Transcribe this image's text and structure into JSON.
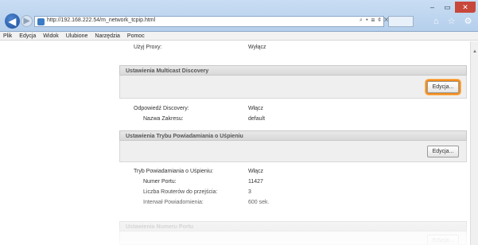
{
  "browser": {
    "url": "http://192.168.222.54/m_network_tcpip.html",
    "window_controls": {
      "minimize": "–",
      "maximize": "▭",
      "close": "✕"
    },
    "address_tools": "⌕ ▾ ⊞ ¢ ✕",
    "toolbar_icons": "⌂ ☆ ⚙"
  },
  "menu": [
    "Plik",
    "Edycja",
    "Widok",
    "Ulubione",
    "Narzędzia",
    "Pomoc"
  ],
  "proxy": {
    "label": "Użyj Proxy:",
    "value": "Wyłącz"
  },
  "multicast": {
    "title": "Ustawienia Multicast Discovery",
    "edit_label": "Edycja...",
    "response_label": "Odpowiedź Discovery:",
    "response_value": "Włącz",
    "scope_label": "Nazwa Zakresu:",
    "scope_value": "default"
  },
  "sleep": {
    "title": "Ustawienia Trybu Powiadamiania o Uśpieniu",
    "edit_label": "Edycja...",
    "mode_label": "Tryb Powiadamiania o Uśpieniu:",
    "mode_value": "Włącz",
    "port_label": "Numer Portu:",
    "port_value": "11427",
    "routers_label": "Liczba Routerów do przejścia:",
    "routers_value": "3",
    "interval_label": "Interwał Powiadomienia:",
    "interval_value": "600 sek."
  },
  "port_numbers": {
    "title": "Ustawienia Numeru Portu",
    "edit_label": "Edycja..."
  }
}
